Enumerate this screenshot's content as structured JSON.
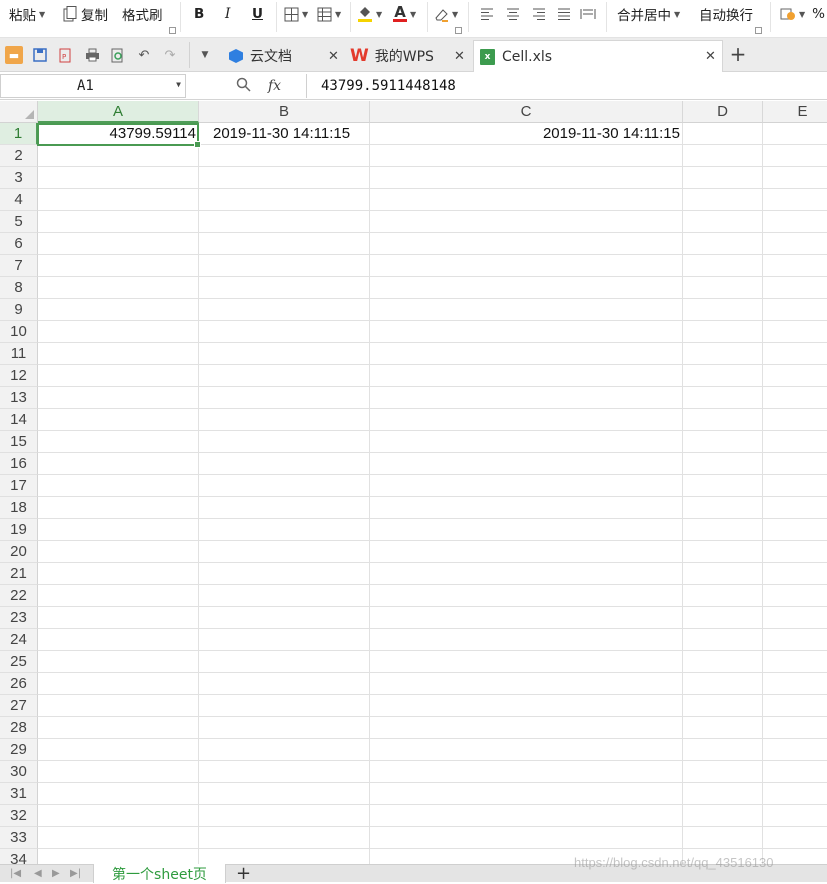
{
  "ribbon": {
    "paste": "粘贴",
    "copy": "复制",
    "format_painter": "格式刷",
    "bold": "B",
    "italic": "I",
    "underline": "U",
    "font_color": "A",
    "merge_center": "合并居中",
    "wrap_text": "自动换行",
    "percent": "%"
  },
  "tabs": [
    {
      "label": "云文档",
      "icon": "cloud-docs-icon"
    },
    {
      "label": "我的WPS",
      "icon": "wps-icon"
    },
    {
      "label": "Cell.xls",
      "icon": "excel-file-icon"
    }
  ],
  "formula_bar": {
    "name_box": "A1",
    "fx": "fx",
    "value": "43799.5911448148"
  },
  "columns": [
    "A",
    "B",
    "C",
    "D",
    "E"
  ],
  "rows": [
    "1",
    "2",
    "3",
    "4",
    "5",
    "6",
    "7",
    "8",
    "9",
    "10",
    "11",
    "12",
    "13",
    "14",
    "15",
    "16",
    "17",
    "18",
    "19",
    "20",
    "21",
    "22",
    "23",
    "24",
    "25",
    "26",
    "27",
    "28",
    "29",
    "30",
    "31",
    "32",
    "33",
    "34"
  ],
  "cells": {
    "A1": "43799.59114",
    "B1": "2019-11-30 14:11:15",
    "C1": "2019-11-30 14:11:15"
  },
  "sheet": {
    "name": "第一个sheet页",
    "add": "+"
  },
  "watermark": "https://blog.csdn.net/qq_43516130",
  "colors": {
    "accent": "#4a9a52",
    "sheet_tab_text": "#2e9b3e"
  }
}
